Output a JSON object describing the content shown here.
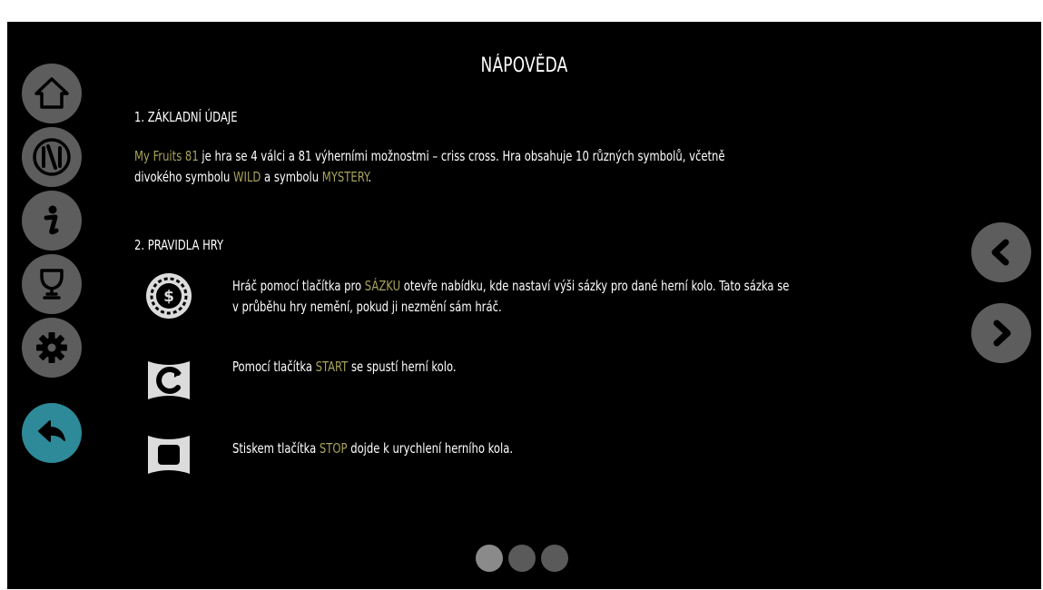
{
  "title": "NÁPOVĚDA",
  "sections": [
    {
      "heading": "1. ZÁKLADNÍ ÚDAJE",
      "para_line1": [
        {
          "text": "My Fruits 81",
          "highlight": true
        },
        {
          "text": " je hra se 4 válci a 81 výherními možnostmi – criss cross. Hra obsahuje 10 různých symbolů, včetně",
          "highlight": false
        }
      ],
      "para_line2": [
        {
          "text": "divokého symbolu ",
          "highlight": false
        },
        {
          "text": "WILD",
          "highlight": true
        },
        {
          "text": " a symbolu ",
          "highlight": false
        },
        {
          "text": "MYSTERY",
          "highlight": true
        },
        {
          "text": ".",
          "highlight": false
        }
      ]
    },
    {
      "heading": "2. PRAVIDLA HRY"
    }
  ],
  "rules": [
    {
      "icon": "bet-coin-icon",
      "line1": [
        {
          "text": "Hráč pomocí tlačítka pro ",
          "highlight": false
        },
        {
          "text": "SÁZKU",
          "highlight": true
        },
        {
          "text": " otevře nabídku, kde nastaví výši sázky pro dané herní kolo. Tato sázka se",
          "highlight": false
        }
      ],
      "line2": [
        {
          "text": "v průběhu hry nemění, pokud ji nezmění sám hráč.",
          "highlight": false
        }
      ]
    },
    {
      "icon": "start-spin-icon",
      "line1": [
        {
          "text": "Pomocí tlačítka ",
          "highlight": false
        },
        {
          "text": "START",
          "highlight": true
        },
        {
          "text": " se spustí herní kolo.",
          "highlight": false
        }
      ]
    },
    {
      "icon": "stop-icon",
      "line1": [
        {
          "text": "Stiskem tlačítka ",
          "highlight": false
        },
        {
          "text": "STOP",
          "highlight": true
        },
        {
          "text": " dojde k urychlení herního kola.",
          "highlight": false
        }
      ]
    }
  ],
  "sidebar": {
    "items": [
      {
        "name": "home-icon"
      },
      {
        "name": "paytable-icon"
      },
      {
        "name": "info-icon"
      },
      {
        "name": "trophy-icon"
      },
      {
        "name": "settings-icon"
      },
      {
        "name": "back-arrow-icon"
      }
    ]
  },
  "navigation": {
    "prev": "chevron-left-icon",
    "next": "chevron-right-icon"
  },
  "pagination": {
    "total": 3,
    "current": 1
  },
  "colors": {
    "background": "#000000",
    "text": "#ffffff",
    "highlight": "#a8a35a",
    "button": "#5d5d5d",
    "back_button": "#2e8a98",
    "dot_active": "#8a8a8a",
    "dot_inactive": "#5a5a5a"
  }
}
